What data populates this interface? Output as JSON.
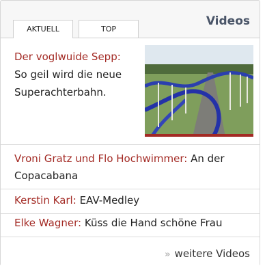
{
  "widget": {
    "title": "Videos"
  },
  "tabs": [
    {
      "label": "AKTUELL",
      "active": true
    },
    {
      "label": "TOP",
      "active": false
    }
  ],
  "featured": {
    "name": "Der voglwuide Sepp:",
    "description": "So geil wird die neue Superachterbahn.",
    "thumbnail_icon": "roller-coaster-thumbnail"
  },
  "items": [
    {
      "artist": "Vroni Gratz und Flo Hochwimmer:",
      "title": "An der Copacabana"
    },
    {
      "artist": "Kerstin Karl:",
      "title": "EAV-Medley"
    },
    {
      "artist": "Elke Wagner:",
      "title": "Küss die Hand schöne Frau"
    }
  ],
  "more_link": {
    "label": "weitere Videos",
    "icon": "double-chevron-right-icon"
  },
  "colors": {
    "accent": "#a32a24",
    "title": "#4a5568",
    "border": "#d6d6d6"
  }
}
